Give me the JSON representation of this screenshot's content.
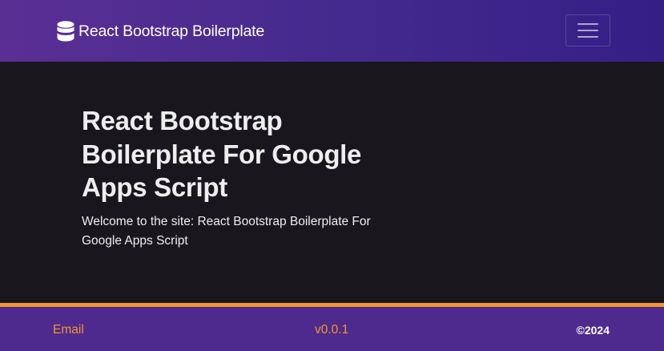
{
  "colors": {
    "navbar_gradient_start": "#5a2f94",
    "navbar_gradient_end": "#341f86",
    "background": "#19171d",
    "footer_bg": "#4e2a8e",
    "accent_orange": "#f0962c",
    "text_light": "#eeeeee"
  },
  "navbar": {
    "brand_icon": "database-icon",
    "brand_text": "React Bootstrap Boilerplate",
    "toggler_icon": "hamburger-menu-icon"
  },
  "hero": {
    "title": "React Bootstrap Boilerplate For Google Apps Script",
    "lead": "Welcome to the site: React Bootstrap Boilerplate For Google Apps Script"
  },
  "footer": {
    "email_link": "Email",
    "version": "v0.0.1",
    "copyright": "©2024"
  }
}
